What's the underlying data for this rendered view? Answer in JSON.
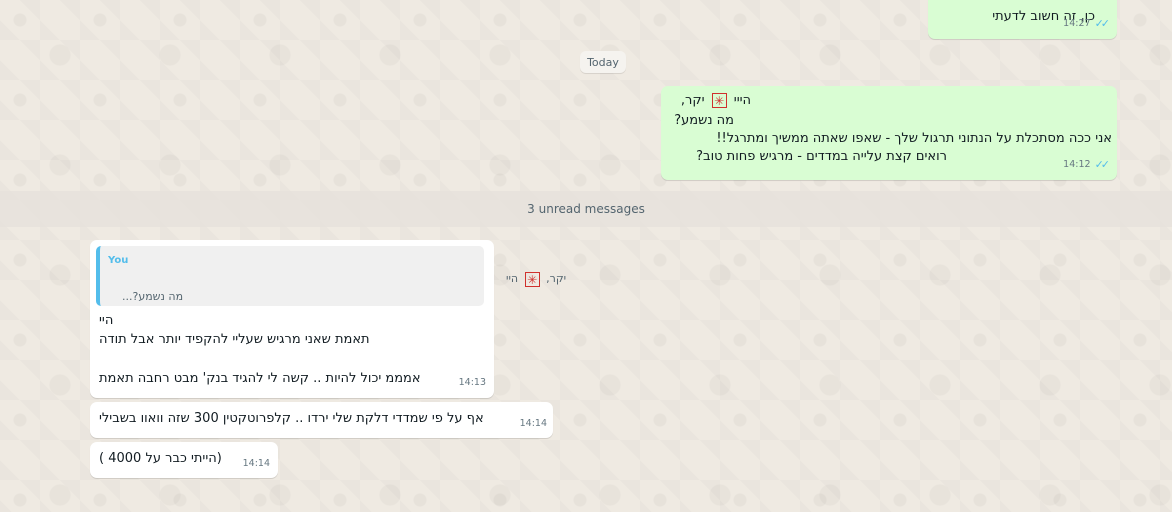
{
  "colors": {
    "outgoing_bubble": "#d9fdd3",
    "incoming_bubble": "#ffffff",
    "chat_background": "#efeae2",
    "read_ticks": "#53bdeb",
    "quote_accent": "#53bdeb"
  },
  "messages": {
    "top_out": {
      "text": "כן, זה חשוב לדעתי",
      "time": "14:27"
    },
    "day_divider": "Today",
    "out_main": {
      "line1_a": "הייי",
      "line1_b": "יקר,",
      "line2": "מה נשמע?",
      "line3": "אני ככה מסתכלת על הנתוני תרגול שלך - שאפו שאתה ממשיך ומתרגל!!",
      "line4": "רואים קצת עלייה במדדים - מרגיש פחות טוב?",
      "time": "14:12"
    },
    "unread_divider": "3 unread messages",
    "in_reply": {
      "quote_author": "You",
      "quote_line1_a": "היי",
      "quote_line1_b": "יקר,",
      "quote_line2": "מה נשמע?...",
      "line1": "היי",
      "line2": "תאמת שאני מרגיש שעליי להקפיד יותר אבל תודה",
      "line3": "אמממ יכול להיות .. קשה לי להגיד בנק' מבט רחבה תאמת",
      "time": "14:13"
    },
    "in_2": {
      "text": "אף על פי שמדדי דלקת שלי ירדו .. קלפרוטקטין 300 שזה וואוו בשבילי",
      "time": "14:14"
    },
    "in_3": {
      "text": "(הייתי כבר על 4000 )",
      "time": "14:14"
    }
  },
  "icons": {
    "emoji_placeholder": "✳",
    "read_ticks": "✓✓"
  }
}
